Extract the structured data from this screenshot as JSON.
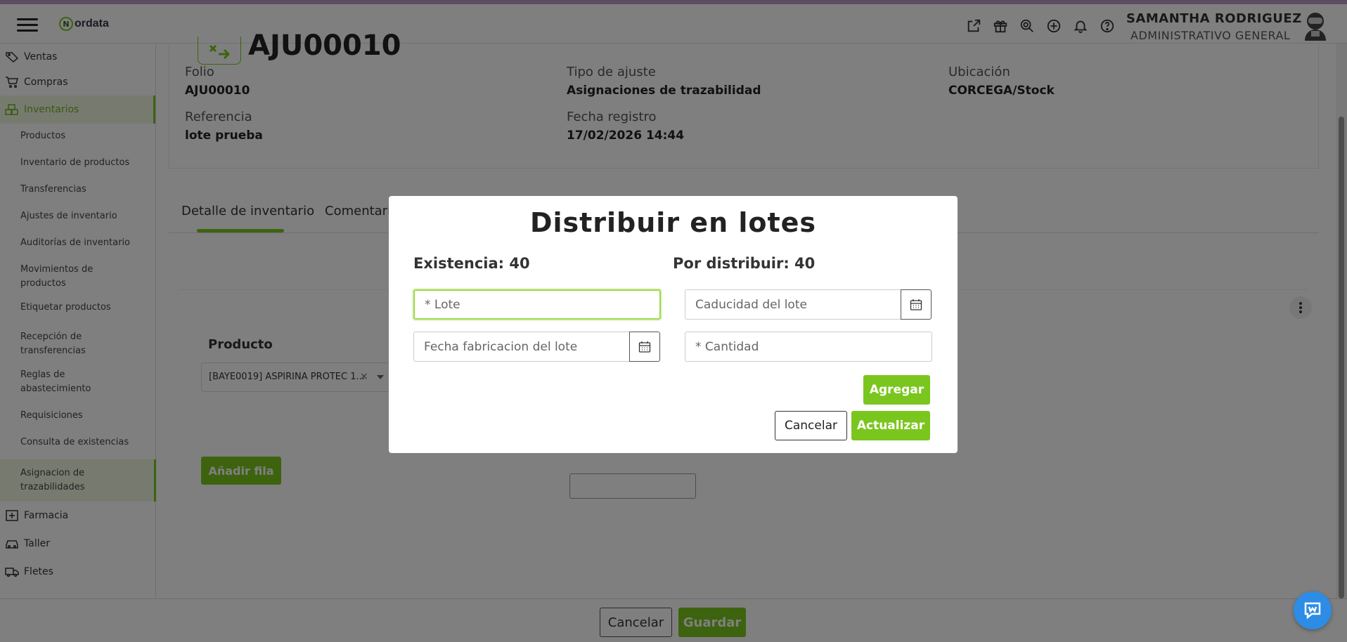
{
  "app": {
    "logo_letter": "N",
    "logo_text": "ordata"
  },
  "user": {
    "name": "SAMANTHA RODRIGUEZ",
    "role": "ADMINISTRATIVO GENERAL"
  },
  "sidebar": {
    "top_items": [
      {
        "label": "Ventas"
      },
      {
        "label": "Compras"
      },
      {
        "label": "Inventarios"
      },
      {
        "label": "Farmacia"
      },
      {
        "label": "Taller"
      },
      {
        "label": "Fletes"
      }
    ],
    "sub_items": [
      "Productos",
      "Inventario de productos",
      "Transferencias",
      "Ajustes de inventario",
      "Auditorías de inventario",
      "Movimientos de productos",
      "Etiquetar productos",
      "Recepción de transferencias",
      "Reglas de abastecimiento",
      "Requisiciones",
      "Consulta de existencias",
      "Asignacion de trazabilidades"
    ]
  },
  "record": {
    "title": "AJU00010",
    "folio_label": "Folio",
    "folio_value": "AJU00010",
    "tipo_label": "Tipo de ajuste",
    "tipo_value": "Asignaciones de trazabilidad",
    "ubicacion_label": "Ubicación",
    "ubicacion_value": "CORCEGA/Stock",
    "referencia_label": "Referencia",
    "referencia_value": "lote prueba",
    "fecha_label": "Fecha registro",
    "fecha_value": "17/02/2026 14:44"
  },
  "tabs": {
    "detalle": "Detalle de inventario",
    "comentarios": "Comentari"
  },
  "detail": {
    "col_producto": "Producto",
    "producto_value": "[BAYE0019] ASPIRINA PROTEC 1...",
    "clear_glyph": "×",
    "add_row": "Añadir fila"
  },
  "footer": {
    "cancel": "Cancelar",
    "save": "Guardar"
  },
  "modal": {
    "title": "Distribuir en lotes",
    "existencia": "Existencia: 40",
    "por_distribuir": "Por distribuir: 40",
    "lote_placeholder": "* Lote",
    "caducidad_placeholder": "Caducidad del lote",
    "fabricacion_placeholder": "Fecha fabricacion del lote",
    "cantidad_placeholder": "* Cantidad",
    "agregar": "Agregar",
    "cancelar": "Cancelar",
    "actualizar": "Actualizar"
  },
  "colors": {
    "accent": "#7bc61e",
    "chat": "#2d8ce6"
  }
}
